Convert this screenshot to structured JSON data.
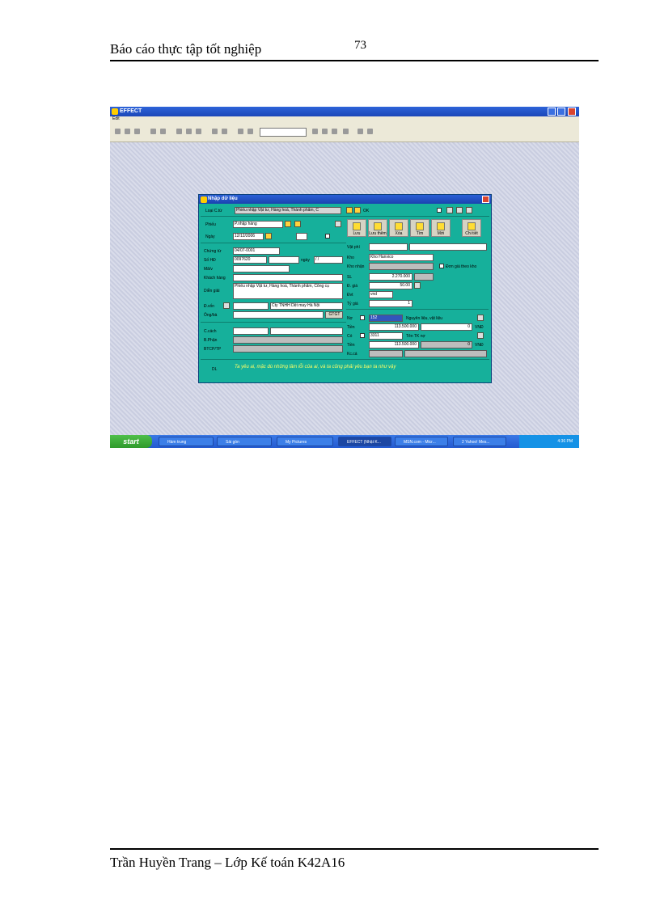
{
  "header": {
    "title": "Báo cáo thực tập tốt nghiệp",
    "page_number": "73"
  },
  "footer": {
    "text": "Trần Huyền Trang – Lớp Kế toán K42A16"
  },
  "screenshot": {
    "app_title": "EFFECT",
    "menu": "Edit",
    "dialog": {
      "title": "Nhập dữ liệu",
      "loai_ct_label": "Loại C.từ",
      "loai_ct_value": "Phiếu nhập Vật tư, Hàng hoá, Thành phẩm, C",
      "ok_label": "OK",
      "phieu_label": "Phiếu",
      "phieu_value": "P.nhập hàng",
      "ngay_label": "Ngày",
      "ngay_value": "12/12/2006",
      "chung_tu_label": "Chứng từ",
      "chung_tu_value": "04/07-0001",
      "so_hd_label": "Số HĐ",
      "so_hd_value": "0097620",
      "ngay_hd_label": "ngày",
      "ngay_hd_value": "/ /",
      "ky_hieu_label": "Mã/v",
      "khach_hang_label": "Khách hàng",
      "dien_giai_label": "Diễn giải",
      "dien_giai_value": "Phiếu nhập Vật tư, Hàng hoá, Thành phẩm, Công cụ",
      "dv_label": "Đ.vốn",
      "dv_value": "Cty TNHH Dệt may Hà Nội",
      "ong_ba_label": "Ông/bà",
      "gtgt_label": "GTGT",
      "c_cach_label": "C.cách",
      "b_phan_label": "B.Phận",
      "btc_label": "BTCP/TP",
      "buttons": [
        "Lưu",
        "Lưu thêm",
        "Xóa",
        "Tìm",
        "Mới",
        "Chi tiết"
      ],
      "vat_tu_label": "Vật phí",
      "kho_label": "Kho",
      "kho_value": "Kho Hanvico",
      "kho_nhan_label": "Kho nhận",
      "don_gia_chk": "Đơn giá theo kho",
      "sl_label": "SL",
      "sl_value": "2.270.000",
      "dgia_label": "Đ. giá",
      "dgia_value": "50.00",
      "dvt_label": "Đvt",
      "dvt_value": "vnd",
      "ty_gia_label": "Tỷ giá",
      "ty_gia_value": "1",
      "no_label": "Nợ",
      "no_acct": "152",
      "no_desc": "Nguyên liệu, vật liệu",
      "tien1_label": "Tiền",
      "tien1_value": "113.500.000",
      "tien1_zero": "0",
      "co_label": "Có",
      "co_acct": "3311",
      "co_desc": "Tên TK nợ",
      "tien2_label": "Tiền",
      "tien2_value": "113.500.000",
      "tien2_zero": "0",
      "kc_label": "Kc.cá",
      "vnd_label": "VNĐ",
      "dl_label": "DL",
      "note": "Ta yêu ai, mặc dù những lầm lỗi của ai, và ta cũng phải yêu bạn ta như vậy"
    },
    "taskbar": {
      "start": "start",
      "tasks": [
        "Hàm trung",
        "Sài gòn",
        "My Pictures",
        "EFFECT (Nhật K...",
        "MSN.com - Micr...",
        "2 Yahoo! Mes..."
      ],
      "clock": "4:36 PM"
    }
  }
}
